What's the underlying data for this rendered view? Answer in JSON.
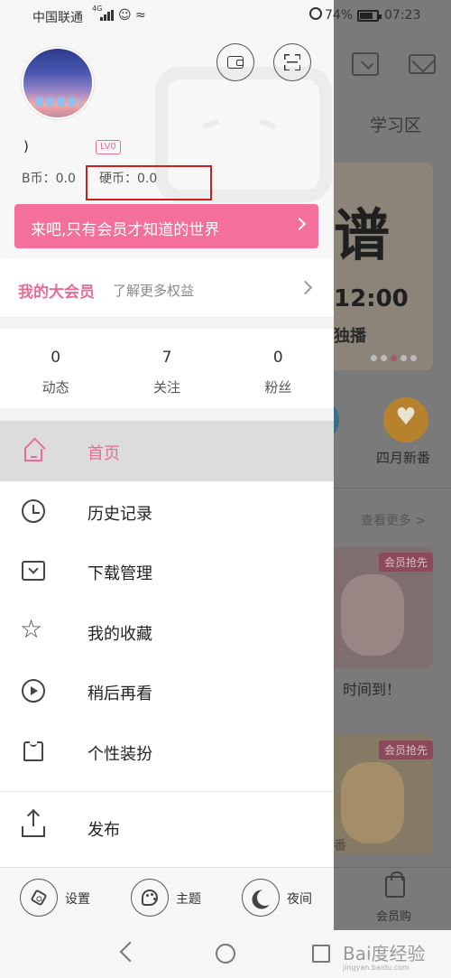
{
  "status_bar": {
    "carrier": "中国联通",
    "network": "4G",
    "battery_percent": "74%",
    "time": "07:23"
  },
  "background_app": {
    "tab": "学习区",
    "banner_title": "谱",
    "banner_time": "12:00",
    "banner_live": "独播",
    "round_label": "四月新番",
    "see_more": "查看更多 >",
    "card_badge_1": "会员抢先",
    "card_caption": "时间到！",
    "card_badge_2": "会员抢先",
    "card_sub": "番",
    "bottom_tab": "会员购"
  },
  "drawer": {
    "username": ")",
    "level": "LV0",
    "b_coin": "B币：0.0",
    "hard_coin": "硬币：0.0",
    "vip_banner": "来吧,只有会员才知道的世界",
    "vip_row": {
      "title": "我的大会员",
      "subtitle": "了解更多权益"
    },
    "stats": [
      {
        "value": "0",
        "label": "动态"
      },
      {
        "value": "7",
        "label": "关注"
      },
      {
        "value": "0",
        "label": "粉丝"
      }
    ],
    "menu": [
      {
        "label": "首页",
        "icon": "home-icon",
        "active": true
      },
      {
        "label": "历史记录",
        "icon": "history-icon"
      },
      {
        "label": "下载管理",
        "icon": "download-icon"
      },
      {
        "label": "我的收藏",
        "icon": "star-icon"
      },
      {
        "label": "稍后再看",
        "icon": "watch-later-icon"
      },
      {
        "label": "个性装扮",
        "icon": "shirt-icon"
      },
      {
        "label": "发布",
        "icon": "upload-icon"
      }
    ],
    "footer": {
      "settings": "设置",
      "theme": "主题",
      "night": "夜间"
    }
  },
  "watermark": {
    "text": "Bai度经验",
    "sub": "jingyan.baidu.com"
  },
  "colors": {
    "accent_pink": "#f46f99",
    "highlight_red": "#cc1f1f"
  }
}
